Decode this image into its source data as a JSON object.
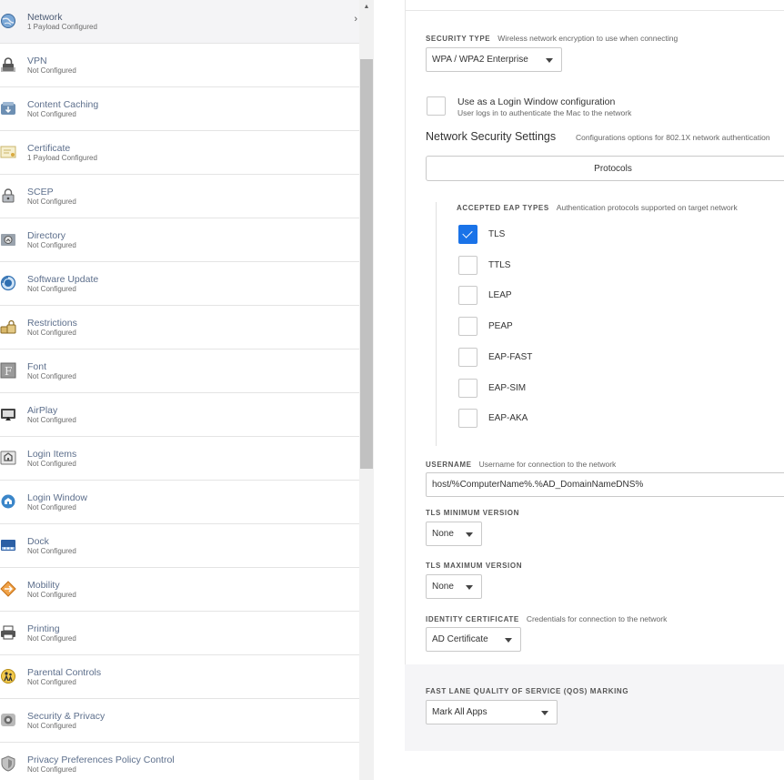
{
  "sidebar": {
    "items": [
      {
        "title": "Network",
        "subtitle": "1 Payload Configured",
        "icon": "globe-icon",
        "active": true
      },
      {
        "title": "VPN",
        "subtitle": "Not Configured",
        "icon": "lock-icon"
      },
      {
        "title": "Content Caching",
        "subtitle": "Not Configured",
        "icon": "cache-box-icon"
      },
      {
        "title": "Certificate",
        "subtitle": "1 Payload Configured",
        "icon": "certificate-icon"
      },
      {
        "title": "SCEP",
        "subtitle": "Not Configured",
        "icon": "scep-lock-icon"
      },
      {
        "title": "Directory",
        "subtitle": "Not Configured",
        "icon": "directory-icon"
      },
      {
        "title": "Software Update",
        "subtitle": "Not Configured",
        "icon": "software-update-icon"
      },
      {
        "title": "Restrictions",
        "subtitle": "Not Configured",
        "icon": "restrictions-lock-icon"
      },
      {
        "title": "Font",
        "subtitle": "Not Configured",
        "icon": "font-icon"
      },
      {
        "title": "AirPlay",
        "subtitle": "Not Configured",
        "icon": "airplay-icon"
      },
      {
        "title": "Login Items",
        "subtitle": "Not Configured",
        "icon": "login-items-icon"
      },
      {
        "title": "Login Window",
        "subtitle": "Not Configured",
        "icon": "login-window-icon"
      },
      {
        "title": "Dock",
        "subtitle": "Not Configured",
        "icon": "dock-icon"
      },
      {
        "title": "Mobility",
        "subtitle": "Not Configured",
        "icon": "mobility-icon"
      },
      {
        "title": "Printing",
        "subtitle": "Not Configured",
        "icon": "printer-icon"
      },
      {
        "title": "Parental Controls",
        "subtitle": "Not Configured",
        "icon": "parental-controls-icon"
      },
      {
        "title": "Security & Privacy",
        "subtitle": "Not Configured",
        "icon": "security-privacy-icon"
      },
      {
        "title": "Privacy Preferences Policy Control",
        "subtitle": "Not Configured",
        "icon": "privacy-shield-icon"
      }
    ],
    "chevron": "›"
  },
  "scrollbar": {
    "up_arrow": "▲"
  },
  "main": {
    "security_type": {
      "label": "SECURITY TYPE",
      "description": "Wireless network encryption to use when connecting",
      "value": "WPA / WPA2 Enterprise"
    },
    "login_window": {
      "label": "Use as a Login Window configuration",
      "description": "User logs in to authenticate the Mac to the network",
      "checked": false
    },
    "network_security": {
      "title": "Network Security Settings",
      "description": "Configurations options for 802.1X network authentication"
    },
    "protocols_tab": "Protocols",
    "eap": {
      "label": "ACCEPTED EAP TYPES",
      "description": "Authentication protocols supported on target network",
      "types": [
        {
          "name": "TLS",
          "checked": true
        },
        {
          "name": "TTLS",
          "checked": false
        },
        {
          "name": "LEAP",
          "checked": false
        },
        {
          "name": "PEAP",
          "checked": false
        },
        {
          "name": "EAP-FAST",
          "checked": false
        },
        {
          "name": "EAP-SIM",
          "checked": false
        },
        {
          "name": "EAP-AKA",
          "checked": false
        }
      ]
    },
    "username": {
      "label": "USERNAME",
      "description": "Username for connection to the network",
      "value": "host/%ComputerName%.%AD_DomainNameDNS%"
    },
    "tls_min": {
      "label": "TLS MINIMUM VERSION",
      "value": "None"
    },
    "tls_max": {
      "label": "TLS MAXIMUM VERSION",
      "value": "None"
    },
    "identity_cert": {
      "label": "IDENTITY CERTIFICATE",
      "description": "Credentials for connection to the network",
      "value": "AD Certificate"
    },
    "qos": {
      "label": "FAST LANE QUALITY OF SERVICE (QOS) MARKING",
      "value": "Mark All Apps"
    }
  },
  "colors": {
    "accent": "#1a73e8",
    "sidebar_title": "#5d6f8c",
    "active_row": "#f4f4f6",
    "qos_band": "#f5f5f7"
  }
}
